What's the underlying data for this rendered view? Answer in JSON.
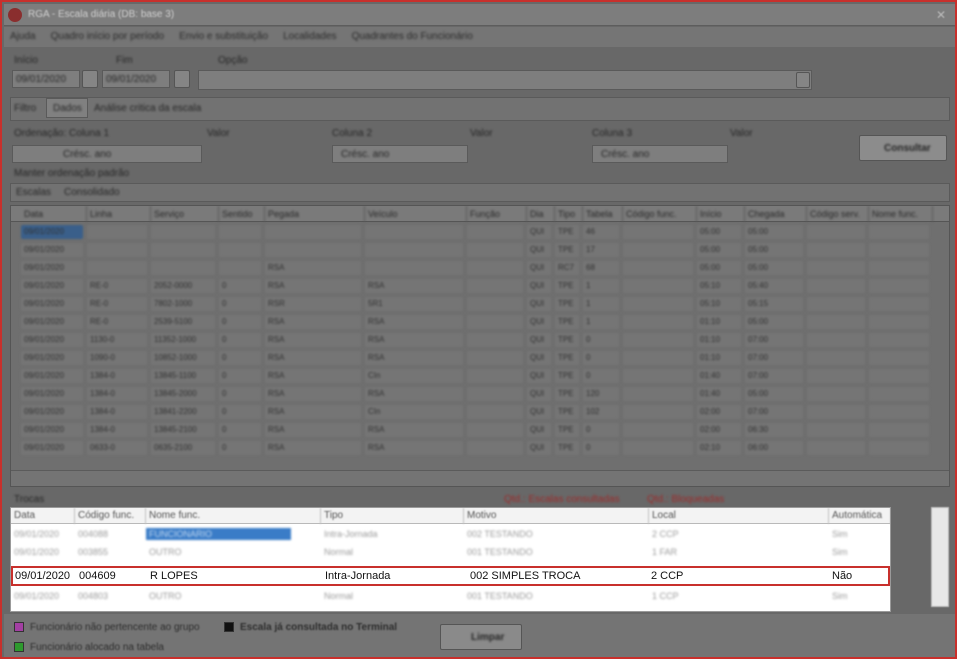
{
  "window": {
    "title": "RGA - Escala diária (DB: base 3)"
  },
  "menu": {
    "items": [
      "Ajuda",
      "Quadro início por período",
      "Envio e substituição",
      "Localidades",
      "Quadrantes do Funcionário"
    ]
  },
  "filters": {
    "inicio_label": "Início",
    "inicio_value": "09/01/2020",
    "fim_label": "Fim",
    "fim_value": "09/01/2020",
    "opcao_label": "Opção",
    "tabs": [
      "Filtro",
      "Dados",
      "Análise critica da escala"
    ],
    "ordenacao_label": "Ordenação: Coluna 1",
    "coluna2_label": "Coluna 2",
    "coluna3_label": "Coluna 3",
    "valor_label": "Valor",
    "order_value": "Crésc. ano",
    "default_check_label": "Manter ordenação padrão",
    "consultar_label": "Consultar",
    "subtabs": [
      "Escalas",
      "Consolidado"
    ]
  },
  "grid": {
    "columns": [
      "Data",
      "Linha",
      "Serviço",
      "Sentido",
      "Pegada",
      "Veículo",
      "Função",
      "Dia",
      "Tipo",
      "Tabela",
      "Código func.",
      "Início",
      "Chegada",
      "Código serv.",
      "Nome func."
    ],
    "rows": [
      [
        "09/01/2020",
        "",
        "",
        "",
        "",
        "",
        "",
        "QUI",
        "TPE",
        "46",
        "",
        "05:00",
        "05:00",
        "",
        ""
      ],
      [
        "09/01/2020",
        "",
        "",
        "",
        "",
        "",
        "",
        "QUI",
        "TPE",
        "17",
        "",
        "05:00",
        "05:00",
        "",
        ""
      ],
      [
        "09/01/2020",
        "",
        "",
        "",
        "RSA",
        "",
        "",
        "QUI",
        "RC7",
        "68",
        "",
        "05:00",
        "05:00",
        "",
        ""
      ],
      [
        "09/01/2020",
        "RE-0",
        "2052-0000",
        "0",
        "RSA",
        "RSA",
        "",
        "QUI",
        "TPE",
        "1",
        "",
        "05:10",
        "05:40",
        "",
        ""
      ],
      [
        "09/01/2020",
        "RE-0",
        "7802-1000",
        "0",
        "RSR",
        "5R1",
        "",
        "QUI",
        "TPE",
        "1",
        "",
        "05:10",
        "05:15",
        "",
        ""
      ],
      [
        "09/01/2020",
        "RE-0",
        "2539-5100",
        "0",
        "RSA",
        "RSA",
        "",
        "QUI",
        "TPE",
        "1",
        "",
        "01:10",
        "05:00",
        "",
        ""
      ],
      [
        "09/01/2020",
        "1130-0",
        "11352-1000",
        "0",
        "RSA",
        "RSA",
        "",
        "QUI",
        "TPE",
        "0",
        "",
        "01:10",
        "07:00",
        "",
        ""
      ],
      [
        "09/01/2020",
        "1090-0",
        "10852-1000",
        "0",
        "RSA",
        "RSA",
        "",
        "QUI",
        "TPE",
        "0",
        "",
        "01:10",
        "07:00",
        "",
        ""
      ],
      [
        "09/01/2020",
        "1384-0",
        "13845-1100",
        "0",
        "RSA",
        "CIn",
        "",
        "QUI",
        "TPE",
        "0",
        "",
        "01:40",
        "07:00",
        "",
        ""
      ],
      [
        "09/01/2020",
        "1384-0",
        "13845-2000",
        "0",
        "RSA",
        "RSA",
        "",
        "QUI",
        "TPE",
        "120",
        "",
        "01:40",
        "05:00",
        "",
        ""
      ],
      [
        "09/01/2020",
        "1384-0",
        "13841-2200",
        "0",
        "RSA",
        "CIn",
        "",
        "QUI",
        "TPE",
        "102",
        "",
        "02:00",
        "07:00",
        "",
        ""
      ],
      [
        "09/01/2020",
        "1384-0",
        "13845-2100",
        "0",
        "RSA",
        "RSA",
        "",
        "QUI",
        "TPE",
        "0",
        "",
        "02:00",
        "06:30",
        "",
        ""
      ],
      [
        "09/01/2020",
        "0633-0",
        "0635-2100",
        "0",
        "RSA",
        "RSA",
        "",
        "QUI",
        "TPE",
        "0",
        "",
        "02:10",
        "06:00",
        "",
        ""
      ]
    ]
  },
  "lower": {
    "section_label": "Trocas",
    "status_left": "Qtd.: Escalas consultadas",
    "status_right": "Qtd.: Bloqueadas",
    "columns": [
      "Data",
      "Código func.",
      "Nome func.",
      "Tipo",
      "Motivo",
      "Local",
      "Automática"
    ],
    "blurred_rows": [
      [
        "09/01/2020",
        "004088",
        "FUNCIONARIO",
        "Intra-Jornada",
        "002 TESTANDO",
        "2 CCP",
        "Sim"
      ],
      [
        "09/01/2020",
        "003855",
        "OUTRO",
        "Normal",
        "001 TESTANDO",
        "1 FAR",
        "Sim"
      ],
      [
        "09/01/2020",
        "004803",
        "OUTRO",
        "Normal",
        "001 TESTANDO",
        "1 CCP",
        "Sim"
      ]
    ],
    "highlighted_row": {
      "data": "09/01/2020",
      "codigo": "004609",
      "nome": "R LOPES",
      "tipo": "Intra-Jornada",
      "motivo": "002 SIMPLES TROCA",
      "local": "2 CCP",
      "automatica": "Não"
    }
  },
  "footer": {
    "legend1": "Funcionário não pertencente ao grupo",
    "legend2": "Funcionário alocado na tabela",
    "legend3": "Escala já consultada no Terminal",
    "limpar_label": "Limpar"
  },
  "colors": {
    "highlight_border": "#c8302c",
    "legend1": "#a33fa3",
    "legend2": "#2e9a2e",
    "legend3": "#111111"
  }
}
